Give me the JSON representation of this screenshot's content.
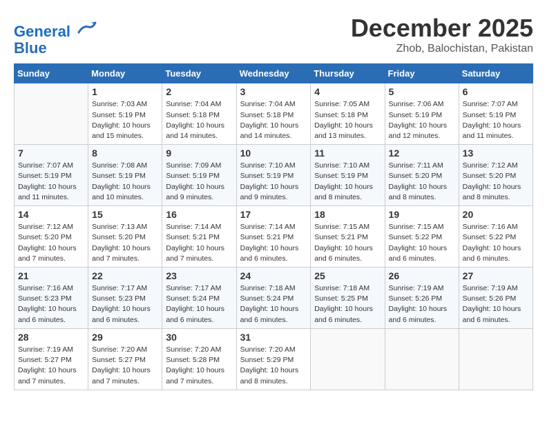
{
  "header": {
    "logo_line1": "General",
    "logo_line2": "Blue",
    "month": "December 2025",
    "location": "Zhob, Balochistan, Pakistan"
  },
  "weekdays": [
    "Sunday",
    "Monday",
    "Tuesday",
    "Wednesday",
    "Thursday",
    "Friday",
    "Saturday"
  ],
  "weeks": [
    [
      {
        "day": "",
        "info": ""
      },
      {
        "day": "1",
        "info": "Sunrise: 7:03 AM\nSunset: 5:19 PM\nDaylight: 10 hours\nand 15 minutes."
      },
      {
        "day": "2",
        "info": "Sunrise: 7:04 AM\nSunset: 5:18 PM\nDaylight: 10 hours\nand 14 minutes."
      },
      {
        "day": "3",
        "info": "Sunrise: 7:04 AM\nSunset: 5:18 PM\nDaylight: 10 hours\nand 14 minutes."
      },
      {
        "day": "4",
        "info": "Sunrise: 7:05 AM\nSunset: 5:18 PM\nDaylight: 10 hours\nand 13 minutes."
      },
      {
        "day": "5",
        "info": "Sunrise: 7:06 AM\nSunset: 5:19 PM\nDaylight: 10 hours\nand 12 minutes."
      },
      {
        "day": "6",
        "info": "Sunrise: 7:07 AM\nSunset: 5:19 PM\nDaylight: 10 hours\nand 11 minutes."
      }
    ],
    [
      {
        "day": "7",
        "info": "Sunrise: 7:07 AM\nSunset: 5:19 PM\nDaylight: 10 hours\nand 11 minutes."
      },
      {
        "day": "8",
        "info": "Sunrise: 7:08 AM\nSunset: 5:19 PM\nDaylight: 10 hours\nand 10 minutes."
      },
      {
        "day": "9",
        "info": "Sunrise: 7:09 AM\nSunset: 5:19 PM\nDaylight: 10 hours\nand 9 minutes."
      },
      {
        "day": "10",
        "info": "Sunrise: 7:10 AM\nSunset: 5:19 PM\nDaylight: 10 hours\nand 9 minutes."
      },
      {
        "day": "11",
        "info": "Sunrise: 7:10 AM\nSunset: 5:19 PM\nDaylight: 10 hours\nand 8 minutes."
      },
      {
        "day": "12",
        "info": "Sunrise: 7:11 AM\nSunset: 5:20 PM\nDaylight: 10 hours\nand 8 minutes."
      },
      {
        "day": "13",
        "info": "Sunrise: 7:12 AM\nSunset: 5:20 PM\nDaylight: 10 hours\nand 8 minutes."
      }
    ],
    [
      {
        "day": "14",
        "info": "Sunrise: 7:12 AM\nSunset: 5:20 PM\nDaylight: 10 hours\nand 7 minutes."
      },
      {
        "day": "15",
        "info": "Sunrise: 7:13 AM\nSunset: 5:20 PM\nDaylight: 10 hours\nand 7 minutes."
      },
      {
        "day": "16",
        "info": "Sunrise: 7:14 AM\nSunset: 5:21 PM\nDaylight: 10 hours\nand 7 minutes."
      },
      {
        "day": "17",
        "info": "Sunrise: 7:14 AM\nSunset: 5:21 PM\nDaylight: 10 hours\nand 6 minutes."
      },
      {
        "day": "18",
        "info": "Sunrise: 7:15 AM\nSunset: 5:21 PM\nDaylight: 10 hours\nand 6 minutes."
      },
      {
        "day": "19",
        "info": "Sunrise: 7:15 AM\nSunset: 5:22 PM\nDaylight: 10 hours\nand 6 minutes."
      },
      {
        "day": "20",
        "info": "Sunrise: 7:16 AM\nSunset: 5:22 PM\nDaylight: 10 hours\nand 6 minutes."
      }
    ],
    [
      {
        "day": "21",
        "info": "Sunrise: 7:16 AM\nSunset: 5:23 PM\nDaylight: 10 hours\nand 6 minutes."
      },
      {
        "day": "22",
        "info": "Sunrise: 7:17 AM\nSunset: 5:23 PM\nDaylight: 10 hours\nand 6 minutes."
      },
      {
        "day": "23",
        "info": "Sunrise: 7:17 AM\nSunset: 5:24 PM\nDaylight: 10 hours\nand 6 minutes."
      },
      {
        "day": "24",
        "info": "Sunrise: 7:18 AM\nSunset: 5:24 PM\nDaylight: 10 hours\nand 6 minutes."
      },
      {
        "day": "25",
        "info": "Sunrise: 7:18 AM\nSunset: 5:25 PM\nDaylight: 10 hours\nand 6 minutes."
      },
      {
        "day": "26",
        "info": "Sunrise: 7:19 AM\nSunset: 5:26 PM\nDaylight: 10 hours\nand 6 minutes."
      },
      {
        "day": "27",
        "info": "Sunrise: 7:19 AM\nSunset: 5:26 PM\nDaylight: 10 hours\nand 6 minutes."
      }
    ],
    [
      {
        "day": "28",
        "info": "Sunrise: 7:19 AM\nSunset: 5:27 PM\nDaylight: 10 hours\nand 7 minutes."
      },
      {
        "day": "29",
        "info": "Sunrise: 7:20 AM\nSunset: 5:27 PM\nDaylight: 10 hours\nand 7 minutes."
      },
      {
        "day": "30",
        "info": "Sunrise: 7:20 AM\nSunset: 5:28 PM\nDaylight: 10 hours\nand 7 minutes."
      },
      {
        "day": "31",
        "info": "Sunrise: 7:20 AM\nSunset: 5:29 PM\nDaylight: 10 hours\nand 8 minutes."
      },
      {
        "day": "",
        "info": ""
      },
      {
        "day": "",
        "info": ""
      },
      {
        "day": "",
        "info": ""
      }
    ]
  ]
}
